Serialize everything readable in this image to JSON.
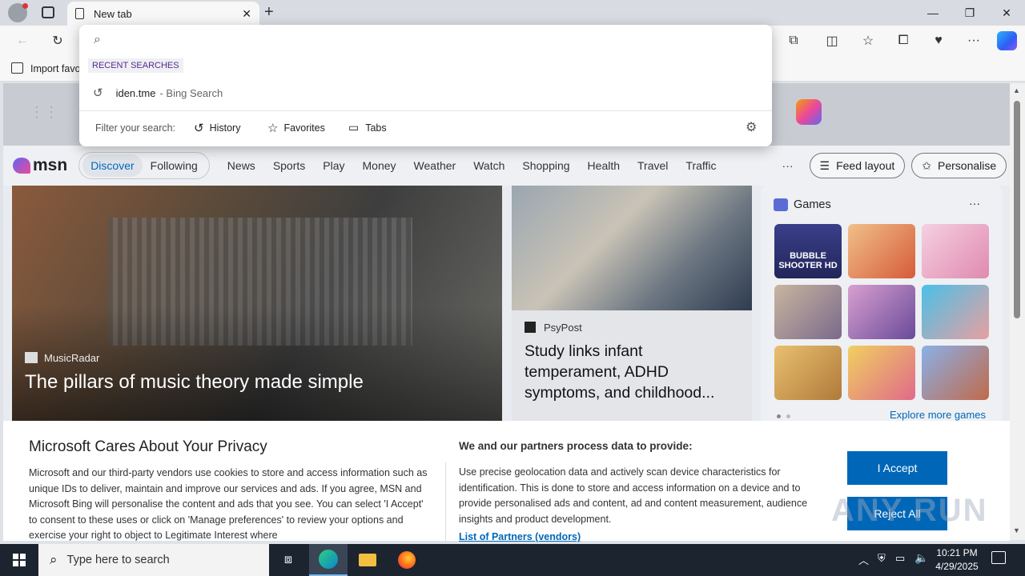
{
  "tab": {
    "title": "New tab"
  },
  "toolbar": {
    "favorites_bar_item": "Import favo"
  },
  "search_dropdown": {
    "section_label": "RECENT SEARCHES",
    "recent_query": "iden.tme",
    "recent_source": "- Bing Search",
    "filter_label": "Filter your search:",
    "filters": [
      "History",
      "Favorites",
      "Tabs"
    ]
  },
  "msn": {
    "logo": "msn",
    "tabs": [
      "Discover",
      "Following"
    ],
    "nav": [
      "News",
      "Sports",
      "Play",
      "Money",
      "Weather",
      "Watch",
      "Shopping",
      "Health",
      "Travel",
      "Traffic"
    ],
    "more": "···",
    "feed_layout": "Feed layout",
    "personalise": "Personalise"
  },
  "cards": {
    "main": {
      "source": "MusicRadar",
      "headline": "The pillars of music theory made simple"
    },
    "second": {
      "source": "PsyPost",
      "headline": "Study links infant temperament, ADHD symptoms, and childhood..."
    },
    "games": {
      "title": "Games",
      "more": "···",
      "explore": "Explore more games",
      "tile1_text": "BUBBLE SHOOTER HD"
    }
  },
  "consent": {
    "title": "Microsoft Cares About Your Privacy",
    "body": "Microsoft and our third-party vendors use cookies to store and access information such as unique IDs to deliver, maintain and improve our services and ads. If you agree, MSN and Microsoft Bing will personalise the content and ads that you see. You can select 'I Accept' to consent to these uses or click on 'Manage preferences' to review your options and exercise your right to object to Legitimate Interest where",
    "right_title": "We and our partners process data to provide:",
    "right_body": "Use precise geolocation data and actively scan device characteristics for identification. This is done to store and access information on a device and to provide personalised ads and content, ad and content measurement, audience insights and product development.",
    "partners_link": "List of Partners (vendors)",
    "accept": "I Accept",
    "reject": "Reject All"
  },
  "watermark": "ANY RUN",
  "taskbar": {
    "search_placeholder": "Type here to search",
    "time": "10:21 PM",
    "date": "4/29/2025"
  },
  "colors": {
    "accent": "#0067b8",
    "link": "#0067b8",
    "taskbar": "#1c2430"
  }
}
